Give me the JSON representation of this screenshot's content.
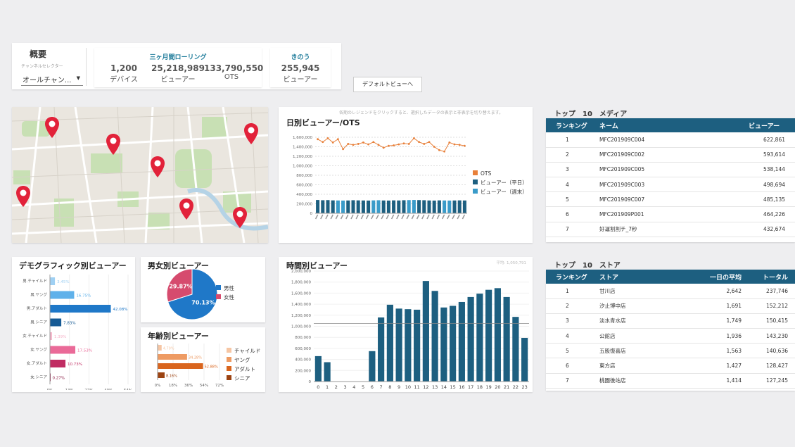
{
  "summary": {
    "title": "概要",
    "selector_label": "チャンネルセレクター",
    "selector_value": "オールチャン...",
    "rolling_title": "三ヶ月間ローリング",
    "devices_value": "1,200",
    "devices_label": "デバイス",
    "viewers_value": "25,218,989",
    "viewers_label": "ビューアー",
    "ots_value": "133,790,550",
    "ots_label": "OTS",
    "yesterday_title": "きのう",
    "yesterday_value": "255,945",
    "yesterday_label": "ビューアー",
    "default_view_button": "デフォルトビューへ"
  },
  "map": {
    "pins": 7
  },
  "daily": {
    "hint": "各期のレジェンドをクリックすると、選択したデータの表示と非表示を切り替えます。",
    "title": "日別ビューアー/OTS",
    "legend": [
      "OTS",
      "ビューアー（平日）",
      "ビューアー（週末）"
    ],
    "colors": {
      "ots": "#e8803a",
      "weekday": "#1d5f80",
      "weekend": "#3a9bc9"
    }
  },
  "chart_data": [
    {
      "type": "line",
      "title": "日別ビューアー/OTS",
      "ylim": [
        0,
        1600000
      ],
      "yticks": [
        "0",
        "200,000",
        "400,000",
        "600,000",
        "800,000",
        "1,000,000",
        "1,200,000",
        "1,400,000",
        "1,600,000"
      ],
      "series": [
        {
          "name": "OTS",
          "values": [
            1560000,
            1500000,
            1580000,
            1490000,
            1560000,
            1350000,
            1460000,
            1440000,
            1460000,
            1490000,
            1450000,
            1500000,
            1440000,
            1380000,
            1420000,
            1430000,
            1450000,
            1470000,
            1460000,
            1580000,
            1500000,
            1460000,
            1500000,
            1400000,
            1330000,
            1300000,
            1490000,
            1450000,
            1440000,
            1420000
          ]
        },
        {
          "name": "ビューアー（平日）",
          "values": [
            280000,
            275000,
            278000,
            272000,
            270000,
            268000,
            270000,
            275000,
            272000,
            270000,
            268000,
            272000,
            275000,
            270000,
            268000,
            272000,
            270000,
            275000,
            278000,
            280000,
            278000,
            275000,
            270000,
            268000,
            272000,
            270000,
            268000,
            270000,
            272000,
            270000
          ]
        }
      ]
    },
    {
      "type": "bar",
      "title": "デモグラフィック別ビューアー",
      "categories": [
        "男.チャイルド",
        "男.ヤング",
        "男.アダルト",
        "男.シニア",
        "女.チャイルド",
        "女.ヤング",
        "女.アダルト",
        "女.シニア"
      ],
      "values": [
        3.45,
        16.75,
        42.08,
        7.83,
        1.39,
        17.53,
        10.73,
        0.27
      ],
      "value_labels": [
        "3.45%",
        "16.75%",
        "42.08%",
        "7.83%",
        "1.39%",
        "17.53%",
        "10.73%",
        "0.27%"
      ],
      "xticks": [
        "0%",
        "13%",
        "27%",
        "40%",
        "54%"
      ],
      "xlim": [
        0,
        54
      ]
    },
    {
      "type": "pie",
      "title": "男女別ビューアー",
      "categories": [
        "男性",
        "女性"
      ],
      "values": [
        70.13,
        29.87
      ],
      "value_labels": [
        "70.13%",
        "29.87%"
      ]
    },
    {
      "type": "bar",
      "title": "年齢別ビューアー",
      "categories": [
        "チャイルド",
        "ヤング",
        "アダルト",
        "シニア"
      ],
      "values": [
        4.7,
        34.28,
        52.88,
        8.16
      ],
      "value_labels": [
        "4.70%",
        "34.28%",
        "52.88%",
        "8.16%"
      ],
      "xticks": [
        "0%",
        "18%",
        "36%",
        "54%",
        "72%"
      ],
      "xlim": [
        0,
        72
      ]
    },
    {
      "type": "bar",
      "title": "時間別ビューアー",
      "categories": [
        "0",
        "1",
        "2",
        "3",
        "4",
        "5",
        "6",
        "7",
        "8",
        "9",
        "10",
        "11",
        "12",
        "13",
        "14",
        "15",
        "16",
        "17",
        "18",
        "19",
        "20",
        "21",
        "22",
        "23"
      ],
      "values": [
        460000,
        350000,
        0,
        0,
        0,
        0,
        550000,
        1160000,
        1390000,
        1320000,
        1310000,
        1300000,
        1820000,
        1640000,
        1340000,
        1370000,
        1440000,
        1530000,
        1590000,
        1660000,
        1690000,
        1530000,
        1170000,
        790000
      ],
      "average_line": 1050791,
      "average_label": "平均: 1,050,791",
      "ylim": [
        0,
        2000000
      ],
      "yticks": [
        "0",
        "200,000",
        "400,000",
        "600,000",
        "800,000",
        "1,000,000",
        "1,200,000",
        "1,400,000",
        "1,600,000",
        "1,800,000",
        "2,000,000"
      ]
    }
  ],
  "demo": {
    "title": "デモグラフィック別ビューアー",
    "colors": [
      "#9fd0f3",
      "#5fb1ea",
      "#1f78c8",
      "#165a94",
      "#f6b3c9",
      "#ea6a98",
      "#c02c62",
      "#8b1c44"
    ]
  },
  "gender": {
    "title": "男女別ビューアー",
    "legend": [
      "男性",
      "女性"
    ],
    "colors": [
      "#1f78c8",
      "#d64b6e"
    ]
  },
  "age": {
    "title": "年齢別ビューアー",
    "legend": [
      "チャイルド",
      "ヤング",
      "アダルト",
      "シニア"
    ],
    "colors": [
      "#f6c6a4",
      "#ee9b63",
      "#d9651e",
      "#9c4312"
    ]
  },
  "hourly": {
    "title": "時間別ビューアー",
    "color": "#1d5f80"
  },
  "media": {
    "title": "トップ　10　メディア",
    "headers": [
      "ランキング",
      "ネーム",
      "ビューアー"
    ],
    "rows": [
      [
        "1",
        "MFC201909C004",
        "622,861"
      ],
      [
        "2",
        "MFC201909C002",
        "593,614"
      ],
      [
        "3",
        "MFC201909C005",
        "538,144"
      ],
      [
        "4",
        "MFC201909C003",
        "498,694"
      ],
      [
        "5",
        "MFC201909C007",
        "485,135"
      ],
      [
        "6",
        "MFC201909P001",
        "464,226"
      ],
      [
        "7",
        "好運割割チ_7秒",
        "432,674"
      ]
    ]
  },
  "stores": {
    "title": "トップ　10　ストア",
    "headers": [
      "ランキング",
      "ストア",
      "一日の平均",
      "トータル"
    ],
    "rows": [
      [
        "1",
        "甘川店",
        "2,642",
        "237,746"
      ],
      [
        "2",
        "汐止博中店",
        "1,691",
        "152,212"
      ],
      [
        "3",
        "淡水青水店",
        "1,749",
        "150,415"
      ],
      [
        "4",
        "公館店",
        "1,936",
        "143,230"
      ],
      [
        "5",
        "五股復喜店",
        "1,563",
        "140,636"
      ],
      [
        "6",
        "東方店",
        "1,427",
        "128,427"
      ],
      [
        "7",
        "桃園後站店",
        "1,414",
        "127,245"
      ]
    ]
  }
}
